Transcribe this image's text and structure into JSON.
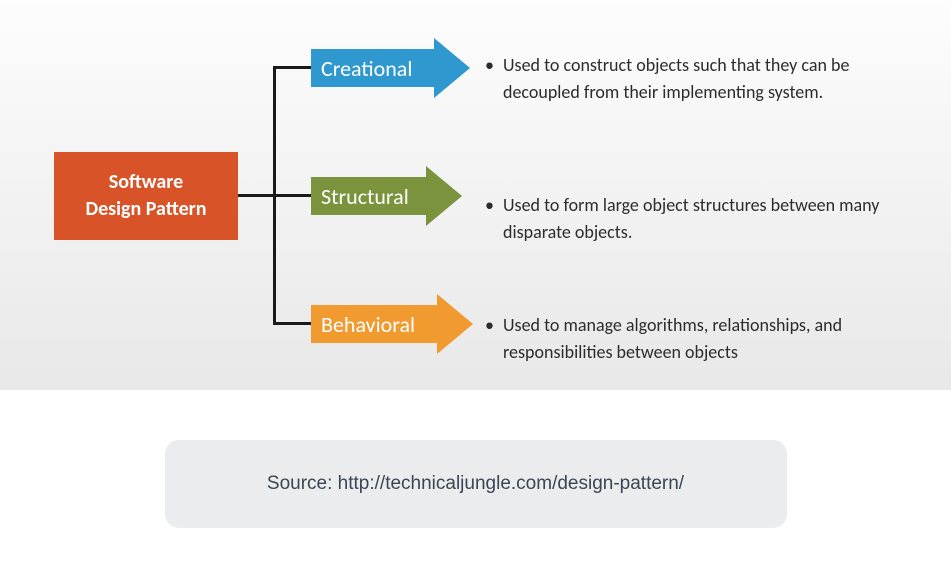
{
  "root": {
    "title": "Software\nDesign Pattern"
  },
  "categories": [
    {
      "label": "Creational",
      "color": "#2e98cf",
      "description": "Used to construct objects such that they can be decoupled from their implementing system."
    },
    {
      "label": "Structural",
      "color": "#7a933c",
      "description": "Used to form large object structures between many disparate objects."
    },
    {
      "label": "Behavioral",
      "color": "#f09a2f",
      "description": "Used to manage algorithms, relationships, and responsibilities between objects"
    }
  ],
  "source": "Source: http://technicaljungle.com/design-pattern/"
}
